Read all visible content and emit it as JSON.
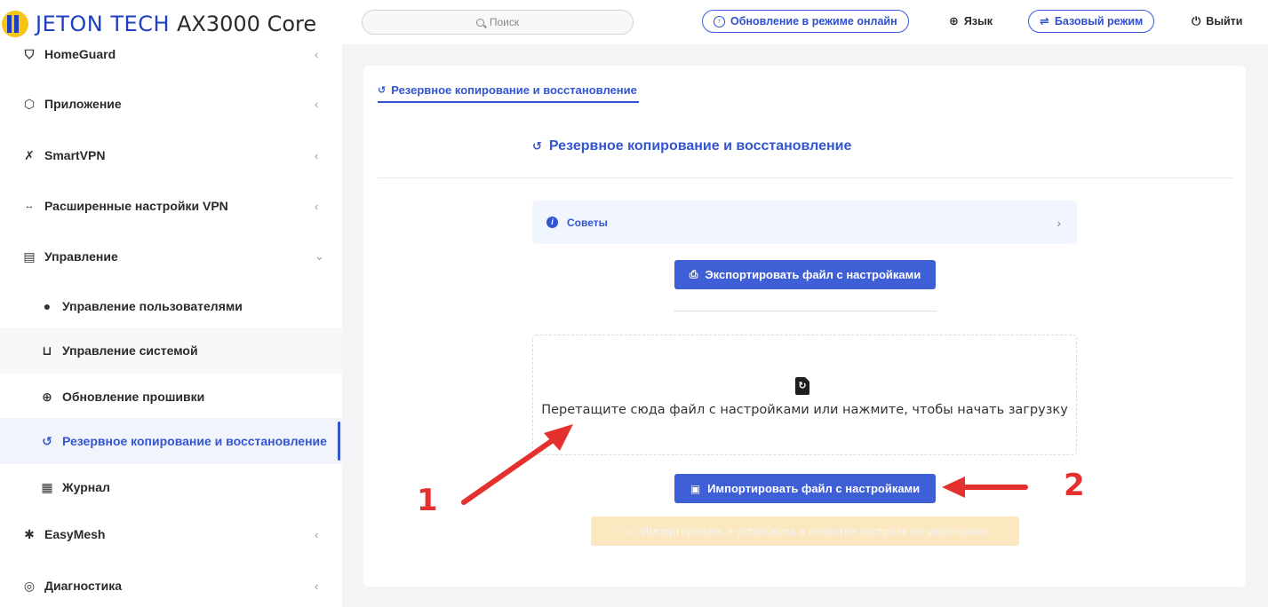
{
  "header": {
    "brand": "JETON TECH",
    "model": "AX3000 Core",
    "search_placeholder": "Поиск",
    "online_update": "Обновление в режиме онлайн",
    "language": "Язык",
    "basic_mode": "Базовый режим",
    "logout": "Выйти"
  },
  "sidebar": {
    "items": [
      {
        "label": "HomeGuard",
        "icon": "shield-icon"
      },
      {
        "label": "Приложение",
        "icon": "cube-icon"
      },
      {
        "label": "SmartVPN",
        "icon": "plug-icon"
      },
      {
        "label": "Расширенные настройки VPN",
        "icon": "arrows-icon"
      },
      {
        "label": "Управление",
        "icon": "toolbox-icon"
      },
      {
        "label": "Управление пользователями",
        "icon": "user-icon"
      },
      {
        "label": "Управление системой",
        "icon": "router-icon"
      },
      {
        "label": "Обновление прошивки",
        "icon": "upgrade-icon"
      },
      {
        "label": "Резервное копирование и восстановление",
        "icon": "restore-icon"
      },
      {
        "label": "Журнал",
        "icon": "log-icon"
      },
      {
        "label": "EasyMesh",
        "icon": "mesh-icon"
      },
      {
        "label": "Диагностика",
        "icon": "diagnostics-icon"
      }
    ]
  },
  "content": {
    "tab_label": "Резервное копирование и восстановление",
    "title": "Резервное копирование и восстановление",
    "tips_label": "Советы",
    "export_button": "Экспортировать файл с настройками",
    "dropzone_text": "Перетащите сюда файл с настройками или нажмите, чтобы начать загрузку",
    "import_button": "Импортировать файл с настройками",
    "import_default_button": "Импортировать и установить в качестве настроек по умолчанию"
  },
  "annotations": {
    "label_1": "1",
    "label_2": "2",
    "color": "#e53030"
  },
  "colors": {
    "accent": "#3455d1",
    "button_blue": "#3f5fd6",
    "button_disabled": "#fbe8c0"
  }
}
